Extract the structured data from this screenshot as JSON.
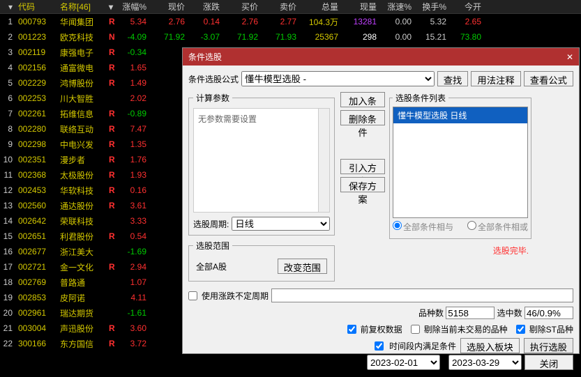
{
  "headers": [
    "代码",
    "名称[46]",
    "涨幅%",
    "现价",
    "涨跌",
    "买价",
    "卖价",
    "总量",
    "现量",
    "涨速%",
    "换手%",
    "今开"
  ],
  "rows": [
    {
      "i": 1,
      "code": "000793",
      "name": "华闻集团",
      "flag": "R",
      "fc": "red",
      "pct": "5.34",
      "pctc": "red",
      "price": "2.76",
      "pricec": "red",
      "chg": "0.14",
      "chgc": "red",
      "bid": "2.76",
      "bidc": "red",
      "ask": "2.77",
      "askc": "red",
      "vol": "104.3万",
      "volc": "yellow",
      "nvol": "13281",
      "nvolc": "purple",
      "speed": "0.00",
      "turn": "5.32",
      "open": "2.65",
      "openc": "red"
    },
    {
      "i": 2,
      "code": "001223",
      "name": "欧克科技",
      "flag": "N",
      "fc": "red",
      "pct": "-4.09",
      "pctc": "green",
      "price": "71.92",
      "pricec": "green",
      "chg": "-3.07",
      "chgc": "green",
      "bid": "71.92",
      "bidc": "green",
      "ask": "71.93",
      "askc": "green",
      "vol": "25367",
      "volc": "yellow",
      "nvol": "298",
      "nvolc": "white",
      "speed": "0.00",
      "turn": "15.21",
      "open": "73.80",
      "openc": "green"
    },
    {
      "i": 3,
      "code": "002119",
      "name": "康强电子",
      "flag": "R",
      "fc": "red",
      "pct": "-0.34",
      "pctc": "green"
    },
    {
      "i": 4,
      "code": "002156",
      "name": "通富微电",
      "flag": "R",
      "fc": "red",
      "pct": "1.65",
      "pctc": "red"
    },
    {
      "i": 5,
      "code": "002229",
      "name": "鸿博股份",
      "flag": "R",
      "fc": "red",
      "pct": "1.49",
      "pctc": "red"
    },
    {
      "i": 6,
      "code": "002253",
      "name": "川大智胜",
      "flag": "",
      "fc": "",
      "pct": "2.02",
      "pctc": "red"
    },
    {
      "i": 7,
      "code": "002261",
      "name": "拓维信息",
      "flag": "R",
      "fc": "red",
      "pct": "-0.89",
      "pctc": "green"
    },
    {
      "i": 8,
      "code": "002280",
      "name": "联络互动",
      "flag": "R",
      "fc": "red",
      "pct": "7.47",
      "pctc": "red"
    },
    {
      "i": 9,
      "code": "002298",
      "name": "中电兴发",
      "flag": "R",
      "fc": "red",
      "pct": "1.35",
      "pctc": "red"
    },
    {
      "i": 10,
      "code": "002351",
      "name": "漫步者",
      "flag": "R",
      "fc": "red",
      "pct": "1.76",
      "pctc": "red"
    },
    {
      "i": 11,
      "code": "002368",
      "name": "太极股份",
      "flag": "R",
      "fc": "red",
      "pct": "1.93",
      "pctc": "red"
    },
    {
      "i": 12,
      "code": "002453",
      "name": "华软科技",
      "flag": "R",
      "fc": "red",
      "pct": "0.16",
      "pctc": "red"
    },
    {
      "i": 13,
      "code": "002560",
      "name": "通达股份",
      "flag": "R",
      "fc": "red",
      "pct": "3.61",
      "pctc": "red"
    },
    {
      "i": 14,
      "code": "002642",
      "name": "荣联科技",
      "flag": "",
      "fc": "",
      "pct": "3.33",
      "pctc": "red"
    },
    {
      "i": 15,
      "code": "002651",
      "name": "利君股份",
      "flag": "R",
      "fc": "red",
      "pct": "0.54",
      "pctc": "red"
    },
    {
      "i": 16,
      "code": "002677",
      "name": "浙江美大",
      "flag": "",
      "fc": "",
      "pct": "-1.69",
      "pctc": "green"
    },
    {
      "i": 17,
      "code": "002721",
      "name": "金一文化",
      "flag": "R",
      "fc": "red",
      "pct": "2.94",
      "pctc": "red"
    },
    {
      "i": 18,
      "code": "002769",
      "name": "普路通",
      "flag": "",
      "fc": "",
      "pct": "1.07",
      "pctc": "red"
    },
    {
      "i": 19,
      "code": "002853",
      "name": "皮阿诺",
      "flag": "",
      "fc": "",
      "pct": "4.11",
      "pctc": "red"
    },
    {
      "i": 20,
      "code": "002961",
      "name": "瑞达期货",
      "flag": "",
      "fc": "",
      "pct": "-1.61",
      "pctc": "green"
    },
    {
      "i": 21,
      "code": "003004",
      "name": "声迅股份",
      "flag": "R",
      "fc": "red",
      "pct": "3.60",
      "pctc": "red"
    },
    {
      "i": 22,
      "code": "300166",
      "name": "东方国信",
      "flag": "R",
      "fc": "red",
      "pct": "3.72",
      "pctc": "red"
    }
  ],
  "dialog": {
    "title": "条件选股",
    "formula_label": "条件选股公式",
    "formula_value": "懂牛模型选股 -",
    "btn_find": "查找",
    "btn_usage": "用法注释",
    "btn_view": "查看公式",
    "params_legend": "计算参数",
    "params_text": "无参数需要设置",
    "period_label": "选股周期:",
    "period_value": "日线",
    "range_legend": "选股范围",
    "range_value": "全部A股",
    "btn_range": "改变范围",
    "btn_add": "加入条件",
    "btn_del": "删除条件",
    "btn_import": "引入方案",
    "btn_save": "保存方案",
    "cond_legend": "选股条件列表",
    "cond_item": "懂牛模型选股 日线",
    "radio_and": "全部条件相与",
    "radio_or": "全部条件相或",
    "status": "选股完毕.",
    "chk_uncertain": "使用涨跌不定周期",
    "stats_count_label": "品种数",
    "stats_count": "5158",
    "stats_hit_label": "选中数",
    "stats_hit": "46/0.9%",
    "chk_fq": "前复权数据",
    "chk_exclude": "剔除当前未交易的品种",
    "chk_st": "剔除ST品种",
    "chk_time": "时间段内满足条件",
    "btn_toblock": "选股入板块",
    "btn_exec": "执行选股",
    "date_from": "2023-02-01",
    "date_to": "2023-03-29",
    "btn_close": "关闭"
  }
}
